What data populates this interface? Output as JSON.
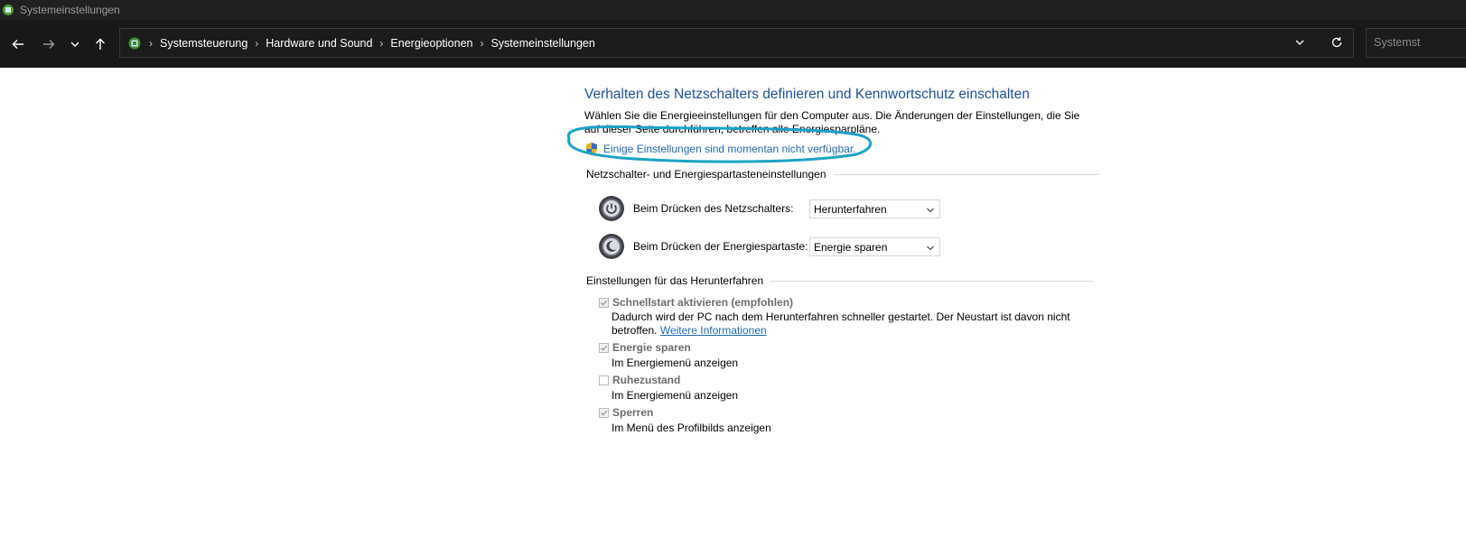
{
  "window": {
    "title": "Systemeinstellungen"
  },
  "address": {
    "breadcrumbs": [
      "Systemsteuerung",
      "Hardware und Sound",
      "Energieoptionen",
      "Systemeinstellungen"
    ],
    "search_placeholder": "Systemst"
  },
  "page": {
    "heading": "Verhalten des Netzschalters definieren und Kennwortschutz einschalten",
    "description": "Wählen Sie die Energieeinstellungen für den Computer aus. Die Änderungen der Einstellungen, die Sie auf dieser Seite durchführen, betreffen alle Energiesparpläne.",
    "unavailable_link": "Einige Einstellungen sind momentan nicht verfügbar.",
    "power_section": {
      "title": "Netzschalter- und Energiespartasteneinstellungen",
      "rows": [
        {
          "label": "Beim Drücken des Netzschalters:",
          "value": "Herunterfahren"
        },
        {
          "label": "Beim Drücken der Energiespartaste:",
          "value": "Energie sparen"
        }
      ]
    },
    "shutdown_section": {
      "title": "Einstellungen für das Herunterfahren",
      "options": [
        {
          "label": "Schnellstart aktivieren (empfohlen)",
          "checked": true,
          "desc_line1": "Dadurch wird der PC nach dem Herunterfahren schneller gestartet. Der Neustart ist davon nicht",
          "desc_line2": "betroffen.",
          "more_link": "Weitere Informationen"
        },
        {
          "label": "Energie sparen",
          "checked": true,
          "desc": "Im Energiemenü anzeigen"
        },
        {
          "label": "Ruhezustand",
          "checked": false,
          "desc": "Im Energiemenü anzeigen"
        },
        {
          "label": "Sperren",
          "checked": true,
          "desc": "Im Menü des Profilbilds anzeigen"
        }
      ]
    }
  },
  "colors": {
    "link": "#1e6ab5",
    "heading": "#1e4f9e",
    "highlight": "#1aa3c4"
  }
}
